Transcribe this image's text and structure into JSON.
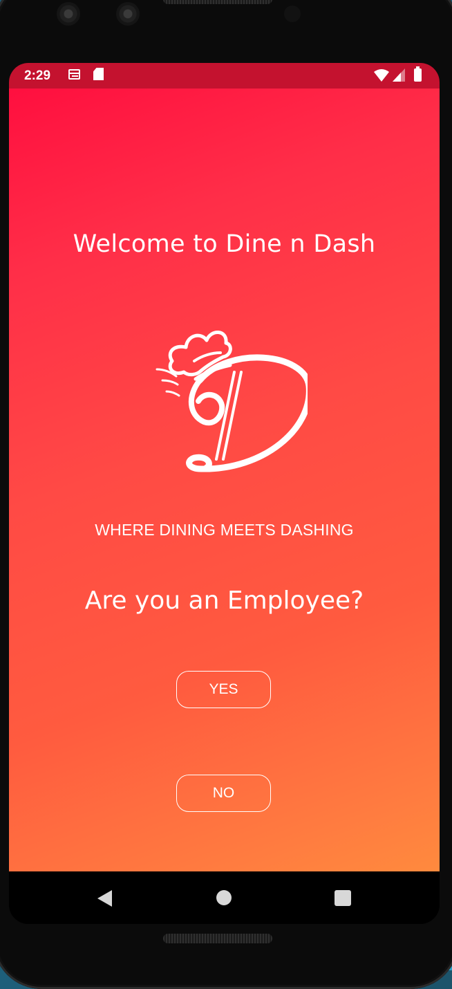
{
  "status_bar": {
    "time": "2:29",
    "icons": [
      "calendar-icon",
      "sd-card-icon",
      "wifi-icon",
      "signal-icon",
      "battery-icon"
    ]
  },
  "app": {
    "welcome_title": "Welcome to Dine n Dash",
    "logo_icon": "chef-hat-d-logo",
    "tagline": "WHERE DINING MEETS DASHING",
    "question": "Are you an Employee?",
    "yes_label": "YES",
    "no_label": "NO"
  },
  "nav_bar": {
    "icons": [
      "back-icon",
      "home-icon",
      "recents-icon"
    ]
  },
  "colors": {
    "status_bar": "#c4122f",
    "gradient_top": "#ff0f3f",
    "gradient_bottom": "#ff8a3e",
    "text": "#ffffff"
  }
}
